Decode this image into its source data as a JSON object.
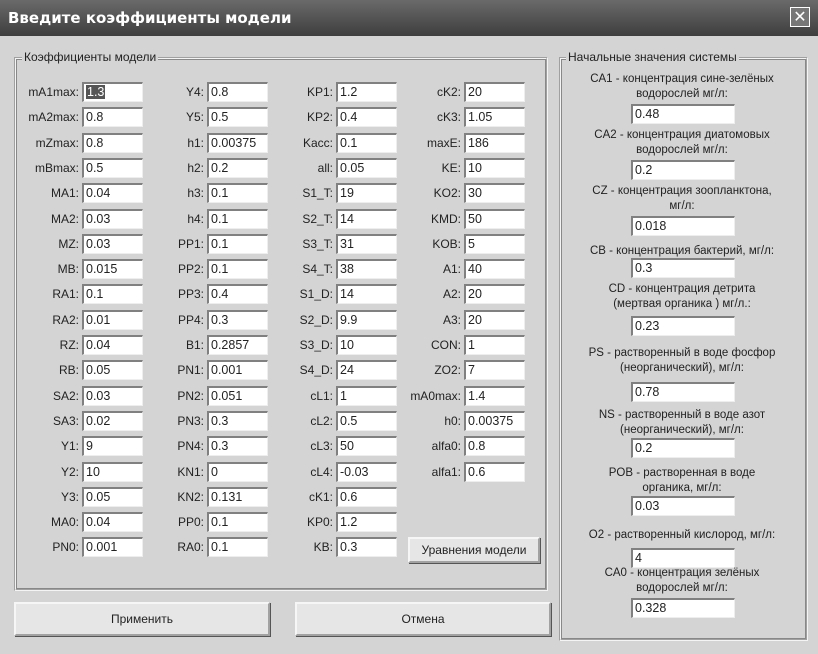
{
  "window": {
    "title": "Введите коэффициенты модели",
    "close_icon": "close-icon"
  },
  "coeffs": {
    "legend": "Коэффициенты модели",
    "columns": [
      [
        [
          "mA1max",
          "1.3"
        ],
        [
          "mA2max",
          "0.8"
        ],
        [
          "mZmax",
          "0.8"
        ],
        [
          "mBmax",
          "0.5"
        ],
        [
          "MA1",
          "0.04"
        ],
        [
          "MA2",
          "0.03"
        ],
        [
          "MZ",
          "0.03"
        ],
        [
          "MB",
          "0.015"
        ],
        [
          "RA1",
          "0.1"
        ],
        [
          "RA2",
          "0.01"
        ],
        [
          "RZ",
          "0.04"
        ],
        [
          "RB",
          "0.05"
        ],
        [
          "SA2",
          "0.03"
        ],
        [
          "SA3",
          "0.02"
        ],
        [
          "Y1",
          "9"
        ],
        [
          "Y2",
          "10"
        ],
        [
          "Y3",
          "0.05"
        ],
        [
          "MA0",
          "0.04"
        ],
        [
          "PN0",
          "0.001"
        ]
      ],
      [
        [
          "Y4",
          "0.8"
        ],
        [
          "Y5",
          "0.5"
        ],
        [
          "h1",
          "0.00375"
        ],
        [
          "h2",
          "0.2"
        ],
        [
          "h3",
          "0.1"
        ],
        [
          "h4",
          "0.1"
        ],
        [
          "PP1",
          "0.1"
        ],
        [
          "PP2",
          "0.1"
        ],
        [
          "PP3",
          "0.4"
        ],
        [
          "PP4",
          "0.3"
        ],
        [
          "B1",
          "0.2857"
        ],
        [
          "PN1",
          "0.001"
        ],
        [
          "PN2",
          "0.051"
        ],
        [
          "PN3",
          "0.3"
        ],
        [
          "PN4",
          "0.3"
        ],
        [
          "KN1",
          "0"
        ],
        [
          "KN2",
          "0.131"
        ],
        [
          "PP0",
          "0.1"
        ],
        [
          "RA0",
          "0.1"
        ]
      ],
      [
        [
          "KP1",
          "1.2"
        ],
        [
          "KP2",
          "0.4"
        ],
        [
          "Kacc",
          "0.1"
        ],
        [
          "all",
          "0.05"
        ],
        [
          "S1_T",
          "19"
        ],
        [
          "S2_T",
          "14"
        ],
        [
          "S3_T",
          "31"
        ],
        [
          "S4_T",
          "38"
        ],
        [
          "S1_D",
          "14"
        ],
        [
          "S2_D",
          "9.9"
        ],
        [
          "S3_D",
          "10"
        ],
        [
          "S4_D",
          "24"
        ],
        [
          "cL1",
          "1"
        ],
        [
          "cL2",
          "0.5"
        ],
        [
          "cL3",
          "50"
        ],
        [
          "cL4",
          "-0.03"
        ],
        [
          "cK1",
          "0.6"
        ],
        [
          "KP0",
          "1.2"
        ],
        [
          "KB",
          "0.3"
        ]
      ],
      [
        [
          "cK2",
          "20"
        ],
        [
          "cK3",
          "1.05"
        ],
        [
          "maxE",
          "186"
        ],
        [
          "KE",
          "10"
        ],
        [
          "KO2",
          "30"
        ],
        [
          "KMD",
          "50"
        ],
        [
          "KOB",
          "5"
        ],
        [
          "A1",
          "40"
        ],
        [
          "A2",
          "20"
        ],
        [
          "A3",
          "20"
        ],
        [
          "CON",
          "1"
        ],
        [
          "ZO2",
          "7"
        ],
        [
          "mA0max",
          "1.4"
        ],
        [
          "h0",
          "0.00375"
        ],
        [
          "alfa0",
          "0.8"
        ],
        [
          "alfa1",
          "0.6"
        ]
      ]
    ],
    "equations_button": "Уравнения модели"
  },
  "initial": {
    "legend": "Начальные значения системы",
    "items": [
      {
        "label": "CA1 - концентрация сине-зелёных\nводорослей мг/л:",
        "value": "0.48"
      },
      {
        "label": "CA2 - концентрация диатомовых\nводорослей  мг/л:",
        "value": "0.2"
      },
      {
        "label": "CZ - концентрация зоопланктона,\nмг/л:",
        "value": "0.018"
      },
      {
        "label": "CB - концентрация бактерий, мг/л:",
        "value": "0.3"
      },
      {
        "label": "CD - концентрация детрита\n(мертвая органика )  мг/л.:",
        "value": "0.23"
      },
      {
        "label": "PS - растворенный в воде фосфор\n(неорганический), мг/л:",
        "value": "0.78"
      },
      {
        "label": "NS - растворенный в воде азот\n(неорганический), мг/л:",
        "value": "0.2"
      },
      {
        "label": "POB - растворенная в воде\nорганика, мг/л:",
        "value": "0.03"
      },
      {
        "label": "O2 - растворенный кислород, мг/л:",
        "value": "4"
      },
      {
        "label": "CA0 - концентрация зелёных\nводорослей мг/л:",
        "value": "0.328"
      }
    ]
  },
  "buttons": {
    "apply": "Применить",
    "cancel": "Отмена"
  }
}
